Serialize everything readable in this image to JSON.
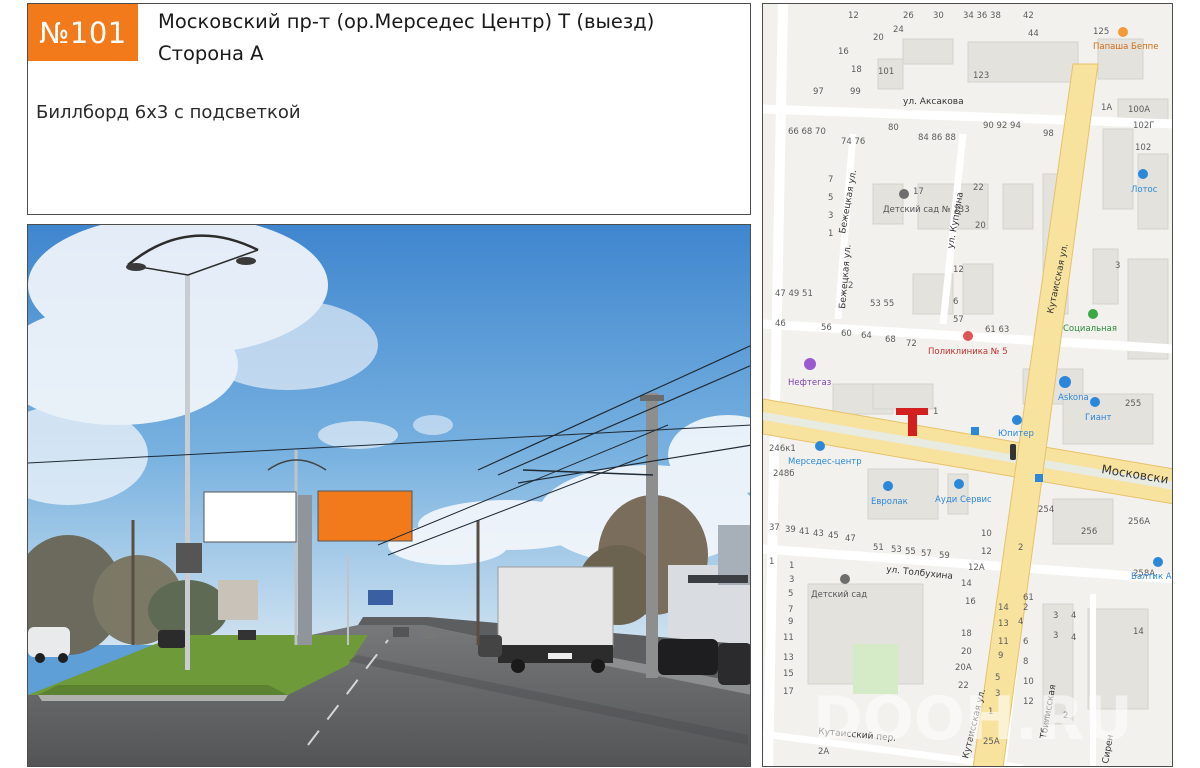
{
  "header": {
    "badge": "№101",
    "title_line1": "Московский пр-т (ор.Мерседес Центр) Т  (выезд)",
    "title_line2": "Сторона А",
    "description": "Биллборд 6х3 с подсветкой"
  },
  "colors": {
    "accent": "#f27a1a",
    "billboard_side_a": "#f27a1a",
    "billboard_blank": "#ffffff",
    "marker": "#d3201f"
  },
  "map": {
    "marker_symbol": "Т",
    "watermark": "DOOH.RU",
    "streets": [
      "ул. Аксакова",
      "Бежецкая ул.",
      "ул. Куприна",
      "Кутаисская ул.",
      "Московски",
      "ул. Толбухина",
      "Кутаисский пер.",
      "Кутаисская ул.",
      "Бежецкая ул.",
      "Сирен",
      "Тбилисская"
    ],
    "pois": [
      {
        "name": "Папаша Беппе",
        "icon": "restaurant-icon"
      },
      {
        "name": "Лотос",
        "icon": "shop-icon"
      },
      {
        "name": "Детский сад № 133",
        "icon": "kindergarten-icon"
      },
      {
        "name": "Социальная",
        "icon": "pharmacy-icon"
      },
      {
        "name": "Поликлиника № 5",
        "icon": "hospital-icon"
      },
      {
        "name": "Нефтегаз",
        "icon": "place-icon"
      },
      {
        "name": "Askona",
        "icon": "shop-icon"
      },
      {
        "name": "Гиант",
        "icon": "shop-icon"
      },
      {
        "name": "Юпитер",
        "icon": "shop-icon"
      },
      {
        "name": "Мерседес-центр",
        "icon": "car-icon"
      },
      {
        "name": "Евролак",
        "icon": "car-icon"
      },
      {
        "name": "Ауди Сервис",
        "icon": "car-icon"
      },
      {
        "name": "Балтик А",
        "icon": "car-icon"
      },
      {
        "name": "Детский сад",
        "icon": "kindergarten-icon"
      }
    ],
    "house_numbers": [
      "12",
      "26",
      "30",
      "34",
      "36",
      "38",
      "42",
      "44",
      "20",
      "24",
      "16",
      "18",
      "101",
      "97",
      "99",
      "125",
      "123",
      "1А",
      "100А",
      "102Г",
      "102",
      "66",
      "68",
      "70",
      "74",
      "76",
      "80",
      "84",
      "86",
      "88",
      "90",
      "92",
      "94",
      "98",
      "17",
      "22",
      "20",
      "12",
      "7",
      "5",
      "3",
      "1",
      "2",
      "47",
      "49",
      "51",
      "53",
      "55",
      "57",
      "61",
      "63",
      "46",
      "56",
      "60",
      "64",
      "68",
      "72",
      "3",
      "255",
      "1",
      "246к1",
      "248б",
      "254",
      "256",
      "256А",
      "258А",
      "37",
      "39",
      "41",
      "43",
      "45",
      "47",
      "51",
      "53",
      "55",
      "57",
      "59",
      "10",
      "12",
      "12А",
      "14",
      "16",
      "18",
      "20",
      "20А",
      "22",
      "2",
      "4",
      "6",
      "8",
      "13",
      "15",
      "11",
      "9",
      "5",
      "3",
      "1",
      "2",
      "4",
      "6",
      "8",
      "10",
      "12",
      "14",
      "61",
      "25А",
      "2А",
      "1"
    ]
  },
  "photo": {
    "description_labels": []
  }
}
